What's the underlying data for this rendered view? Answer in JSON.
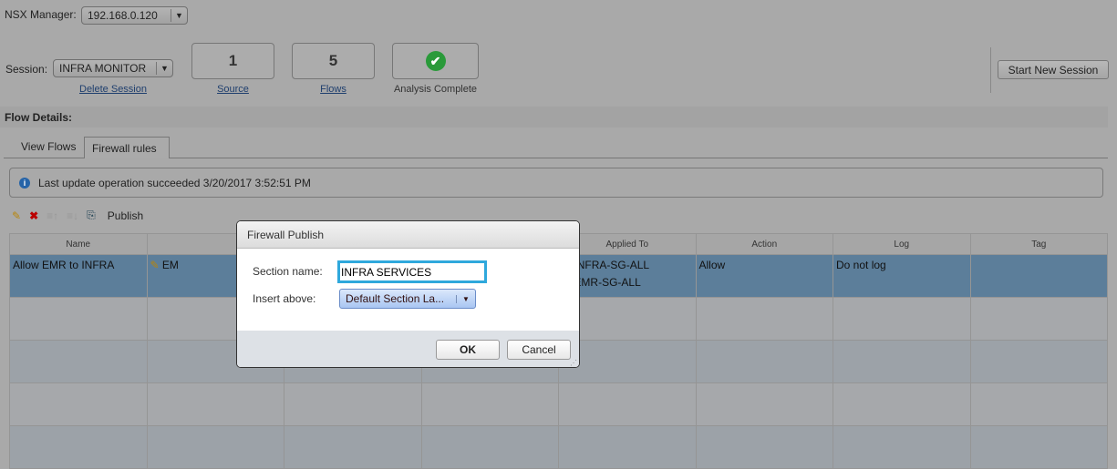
{
  "header": {
    "manager_label": "NSX Manager:",
    "manager_value": "192.168.0.120",
    "session_label": "Session:",
    "session_value": "INFRA MONITOR",
    "delete_session": "Delete Session",
    "source_count": "1",
    "source_label": "Source",
    "flows_count": "5",
    "flows_label": "Flows",
    "analysis_label": "Analysis Complete",
    "start_new_session": "Start New Session"
  },
  "flow_details": {
    "title": "Flow Details:",
    "tabs": [
      {
        "label": "View Flows"
      },
      {
        "label": "Firewall rules",
        "active": true
      }
    ],
    "info": "Last update operation succeeded 3/20/2017 3:52:51 PM",
    "publish_label": "Publish"
  },
  "table": {
    "columns": [
      "Name",
      "",
      "",
      "",
      "Applied To",
      "Action",
      "Log",
      "Tag"
    ],
    "rows": [
      {
        "name": "Allow EMR to INFRA",
        "col2": "EM",
        "applied_to": [
          "INFRA-SG-ALL",
          "EMR-SG-ALL"
        ],
        "action": "Allow",
        "log": "Do not log",
        "tag": ""
      }
    ]
  },
  "dialog": {
    "title": "Firewall Publish",
    "section_label": "Section name:",
    "section_value": "INFRA SERVICES",
    "insert_label": "Insert above:",
    "insert_value": "Default Section La...",
    "ok": "OK",
    "cancel": "Cancel"
  },
  "colors": {
    "accent_border": "#2fa8dc",
    "selected_row": "#5c7e9a",
    "success": "#2a9a3a"
  }
}
